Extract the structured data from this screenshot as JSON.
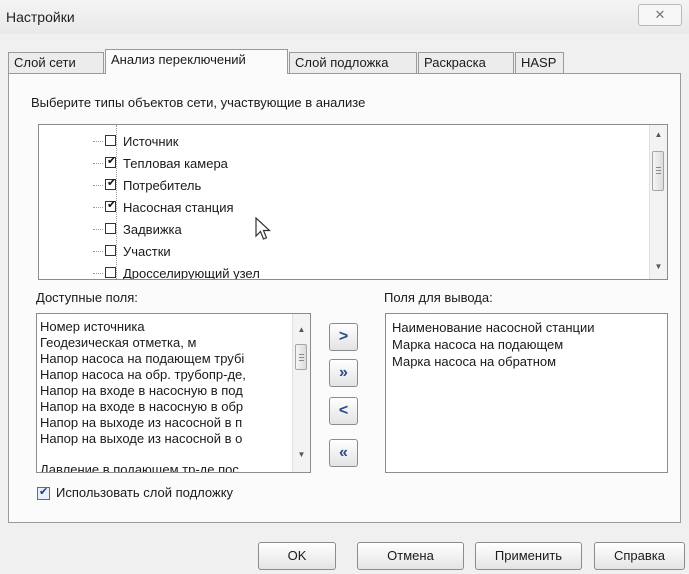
{
  "window": {
    "title": "Настройки",
    "close_glyph": "✕"
  },
  "tabs": [
    {
      "label": "Слой сети"
    },
    {
      "label": "Анализ переключений"
    },
    {
      "label": "Слой подложка"
    },
    {
      "label": "Раскраска"
    },
    {
      "label": "HASP"
    }
  ],
  "active_tab": "Анализ переключений",
  "prompt": "Выберите типы объектов сети, участвующие в анализе",
  "object_types": [
    {
      "label": "Источник",
      "checked": false
    },
    {
      "label": "Тепловая камера",
      "checked": true
    },
    {
      "label": "Потребитель",
      "checked": true
    },
    {
      "label": "Насосная станция",
      "checked": true
    },
    {
      "label": "Задвижка",
      "checked": false
    },
    {
      "label": "Участки",
      "checked": false
    },
    {
      "label": "Дросселирующий узел",
      "checked": false
    }
  ],
  "check_glyph": "✔",
  "available_fields": {
    "label": "Доступные поля:",
    "items": [
      "Номер источника",
      "Геодезическая отметка, м",
      "Напор насоса на подающем трубі",
      "Напор насоса на обр. трубопр-де,",
      "Напор на входе в насосную в под",
      "Напор на входе в насосную в обр",
      "Напор на выходе из насосной в п",
      "Напор на выходе из насосной в о",
      "Давление в подающем тр-де пос"
    ]
  },
  "output_fields": {
    "label": "Поля для вывода:",
    "items": [
      "Наименование насосной станции",
      "Марка насоса на подающем",
      "Марка насоса на обратном"
    ]
  },
  "move_buttons": {
    "add": ">",
    "add_all": "»",
    "remove": "<",
    "remove_all": "«"
  },
  "use_underlay": {
    "label": "Использовать слой подложку",
    "checked": true
  },
  "buttons": {
    "ok": "OK",
    "cancel": "Отмена",
    "apply": "Применить",
    "help": "Справка"
  }
}
